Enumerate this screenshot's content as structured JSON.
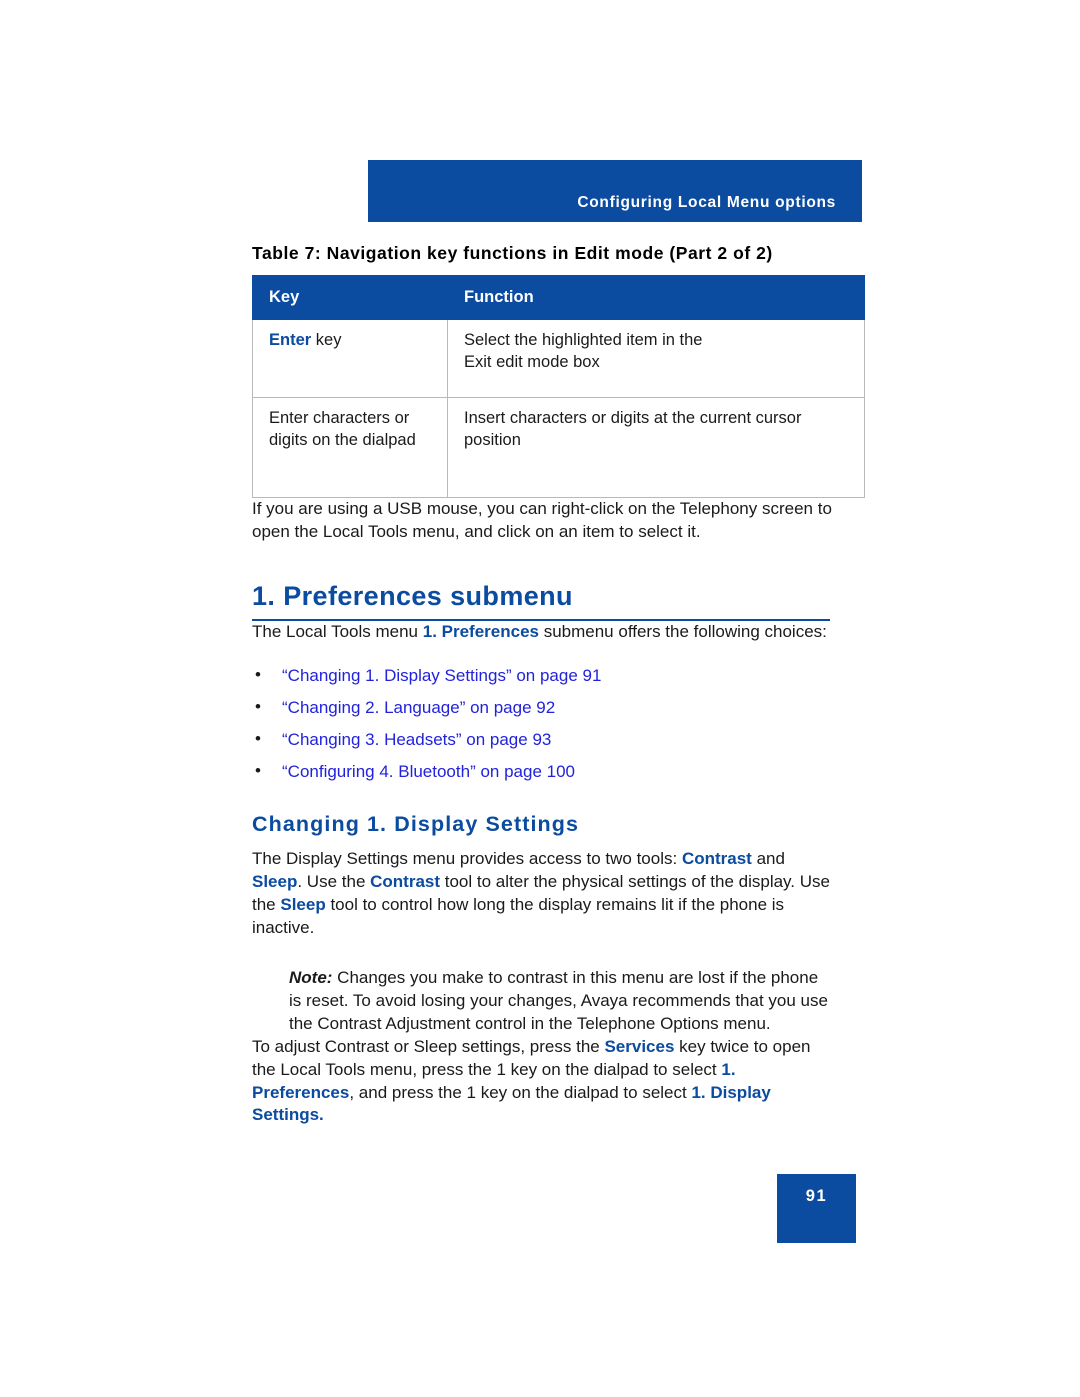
{
  "header": {
    "running_title": "Configuring Local Menu options"
  },
  "table": {
    "caption": "Table 7: Navigation key functions in Edit mode (Part 2 of 2)",
    "columns": [
      "Key",
      "Function"
    ],
    "rows": [
      {
        "key_bold": "Enter",
        "key_rest": " key",
        "function_line1": "Select the highlighted item in the",
        "function_line2": "Exit edit mode box"
      },
      {
        "key_bold": "",
        "key_rest": "Enter characters or digits on the dialpad",
        "function_line1": "Insert characters or digits at the current cursor",
        "function_line2": "position"
      }
    ]
  },
  "body": {
    "usb_mouse_para": "If you are using a USB mouse, you can right-click on the Telephony screen to open the Local Tools menu, and click on an item to select it.",
    "heading1": "1. Preferences submenu",
    "intro_part1": "The Local Tools menu ",
    "intro_bold": "1. Preferences",
    "intro_part2": " submenu offers the following choices:",
    "links": [
      "“Changing 1. Display Settings” on page 91",
      "“Changing 2. Language” on page 92",
      "“Changing 3. Headsets” on page 93",
      "“Configuring 4. Bluetooth” on page 100"
    ],
    "bullet_glyph": "•",
    "heading2": "Changing 1. Display Settings",
    "display_para": {
      "p1": "The Display Settings menu provides access to two tools: ",
      "b1": "Contrast",
      "p2": " and ",
      "b2": "Sleep",
      "p3": ". Use the ",
      "b3": "Contrast",
      "p4": " tool to alter the physical settings of the display. Use the ",
      "b4": "Sleep",
      "p5": " tool to control how long the display remains lit if the phone is inactive."
    },
    "note": {
      "label": "Note:",
      "text": " Changes you make to contrast in this menu are lost if the phone is reset. To avoid losing your changes, Avaya recommends that you use the Contrast Adjustment control in the Telephone Options menu."
    },
    "final_para": {
      "p1": "To adjust Contrast or Sleep settings, press the ",
      "b1": "Services",
      "p2": " key twice to open the Local Tools menu, press the 1 key on the dialpad to select ",
      "b2": "1. Preferences",
      "p3": ", and press the 1 key on the dialpad to select ",
      "b3": "1. Display Settings."
    }
  },
  "footer": {
    "page_number": "91"
  },
  "colors": {
    "brand_blue": "#0b4ba0",
    "link_blue": "#2222dd",
    "table_border": "#b9b9b9",
    "text": "#1a1a1a"
  }
}
